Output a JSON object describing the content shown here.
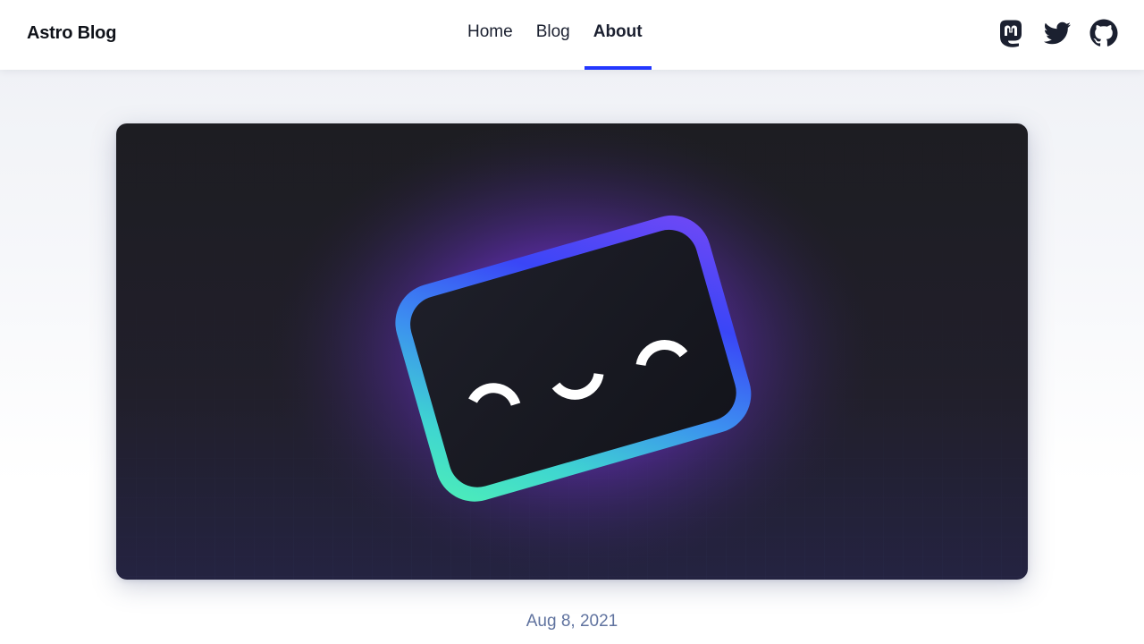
{
  "header": {
    "site_title": "Astro Blog",
    "nav": [
      {
        "label": "Home",
        "active": false
      },
      {
        "label": "Blog",
        "active": false
      },
      {
        "label": "About",
        "active": true
      }
    ],
    "social_icons": [
      "mastodon-icon",
      "twitter-icon",
      "github-icon"
    ]
  },
  "post": {
    "hero_image": "astro-smiling-window-logo",
    "date": "Aug 8, 2021"
  },
  "colors": {
    "accent": "#2337ff",
    "text": "#0f1219",
    "date": "#60739f",
    "hero_bg": "#1c1c22",
    "glow": "#7b3fe4"
  }
}
